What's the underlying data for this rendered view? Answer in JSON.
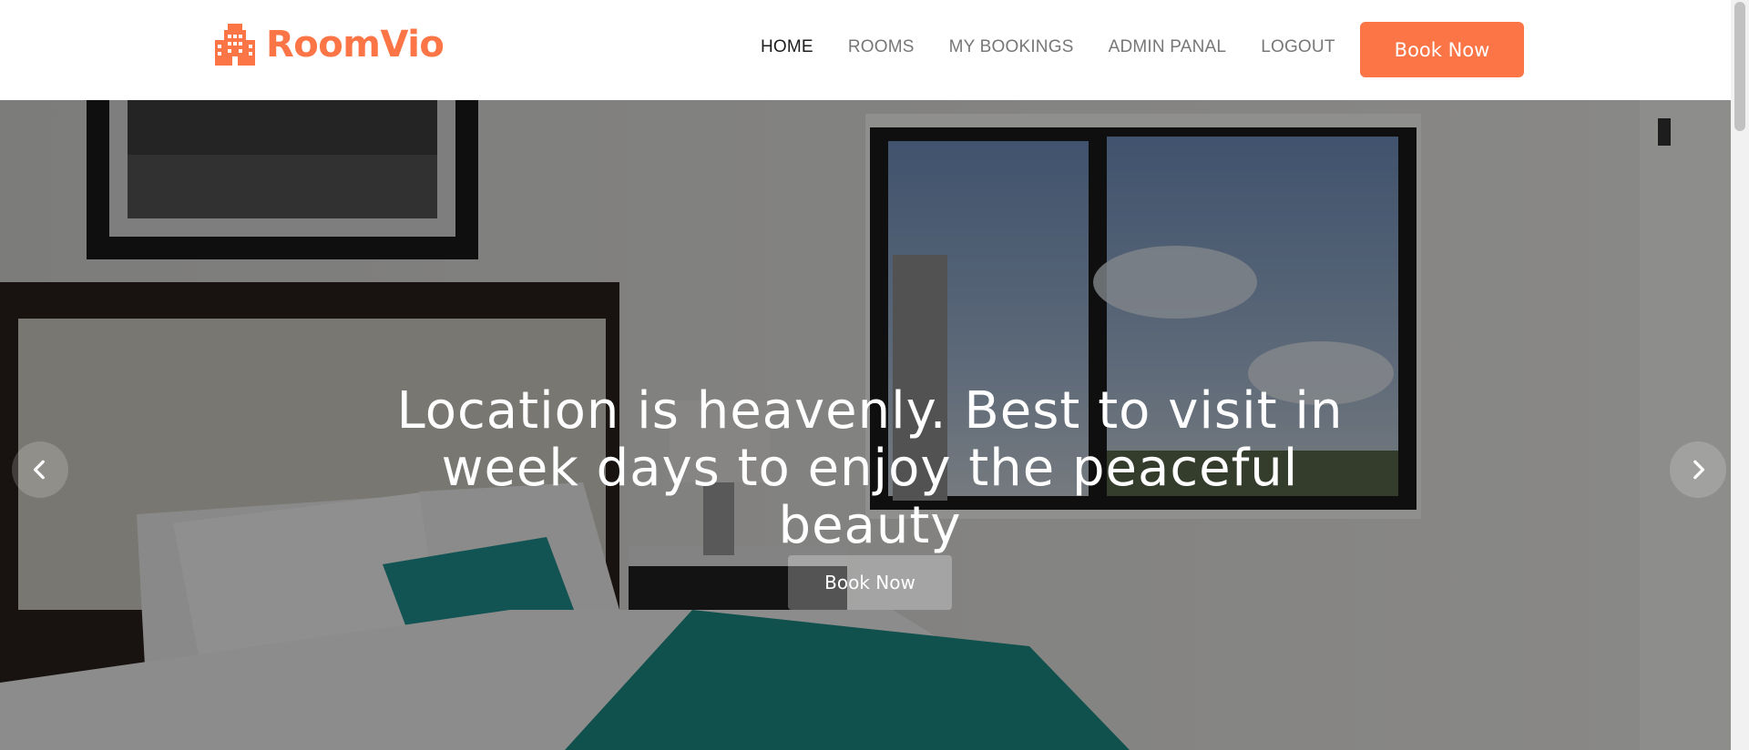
{
  "brand": {
    "name": "RoomVio",
    "icon": "hotel-building-icon",
    "color": "#fb7546"
  },
  "nav": {
    "items": [
      {
        "label": "HOME",
        "active": true
      },
      {
        "label": "ROOMS",
        "active": false
      },
      {
        "label": "MY BOOKINGS",
        "active": false
      },
      {
        "label": "ADMIN PANAL",
        "active": false
      },
      {
        "label": "LOGOUT",
        "active": false
      }
    ],
    "book_label": "Book Now"
  },
  "hero": {
    "title": "Location is heavenly. Best to visit in week days to enjoy the peaceful beauty",
    "button_label": "Book Now",
    "prev_icon": "chevron-left-icon",
    "next_icon": "chevron-right-icon"
  },
  "colors": {
    "accent": "#fb7546",
    "nav_text": "#777777",
    "nav_active": "#1d1d1d"
  }
}
